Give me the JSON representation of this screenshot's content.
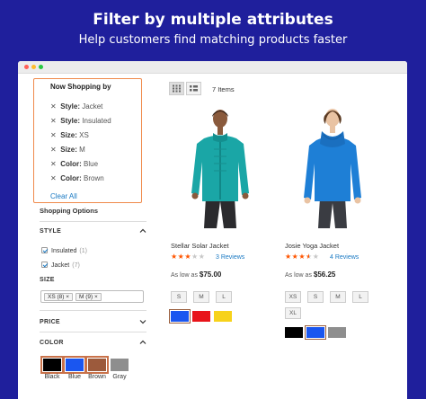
{
  "hero": {
    "title": "Filter by multiple attributes",
    "subtitle": "Help customers find matching products faster"
  },
  "now_shopping": {
    "title": "Now Shopping by",
    "filters": [
      {
        "label": "Style:",
        "value": "Jacket"
      },
      {
        "label": "Style:",
        "value": "Insulated"
      },
      {
        "label": "Size:",
        "value": "XS"
      },
      {
        "label": "Size:",
        "value": "M"
      },
      {
        "label": "Color:",
        "value": "Blue"
      },
      {
        "label": "Color:",
        "value": "Brown"
      }
    ],
    "clear_all": "Clear All"
  },
  "shopping_options": {
    "title": "Shopping Options",
    "style": {
      "heading": "STYLE",
      "options": [
        {
          "label": "Insulated",
          "count": "(1)"
        },
        {
          "label": "Jacket",
          "count": "(7)"
        }
      ]
    },
    "size": {
      "heading": "SIZE",
      "chips": [
        "XS (8) ×",
        "M (9) ×"
      ]
    },
    "price": {
      "heading": "PRICE"
    },
    "color": {
      "heading": "COLOR",
      "swatches": [
        {
          "label": "Black",
          "color": "#000000",
          "selected": false
        },
        {
          "label": "Blue",
          "color": "#1a56f0",
          "selected": false
        },
        {
          "label": "Brown",
          "color": "#9c5a3c",
          "selected": true
        },
        {
          "label": "Gray",
          "color": "#8e8e8e",
          "selected": false
        }
      ]
    }
  },
  "toolbar": {
    "items_count": "7 Items",
    "grid_icon": "grid-icon",
    "list_icon": "list-icon"
  },
  "products": [
    {
      "name": "Stellar Solar Jacket",
      "rating": 3,
      "reviews": "3  Reviews",
      "price_prefix": "As low as",
      "price": "$75.00",
      "sizes": [
        "S",
        "M",
        "L"
      ],
      "colors": [
        {
          "name": "blue",
          "hex": "#1a56f0",
          "selected": true
        },
        {
          "name": "red",
          "hex": "#e8141a",
          "selected": false
        },
        {
          "name": "yellow",
          "hex": "#f7d21b",
          "selected": false
        }
      ],
      "shirt_color": "#1aa6a6"
    },
    {
      "name": "Josie Yoga Jacket",
      "rating": 3.5,
      "reviews": "4  Reviews",
      "price_prefix": "As low as",
      "price": "$56.25",
      "sizes": [
        "XS",
        "S",
        "M",
        "L",
        "XL"
      ],
      "colors": [
        {
          "name": "black",
          "hex": "#000000",
          "selected": false
        },
        {
          "name": "blue",
          "hex": "#1a56f0",
          "selected": true
        },
        {
          "name": "gray",
          "hex": "#8e8e8e",
          "selected": false
        }
      ],
      "shirt_color": "#1e7fd6"
    }
  ]
}
